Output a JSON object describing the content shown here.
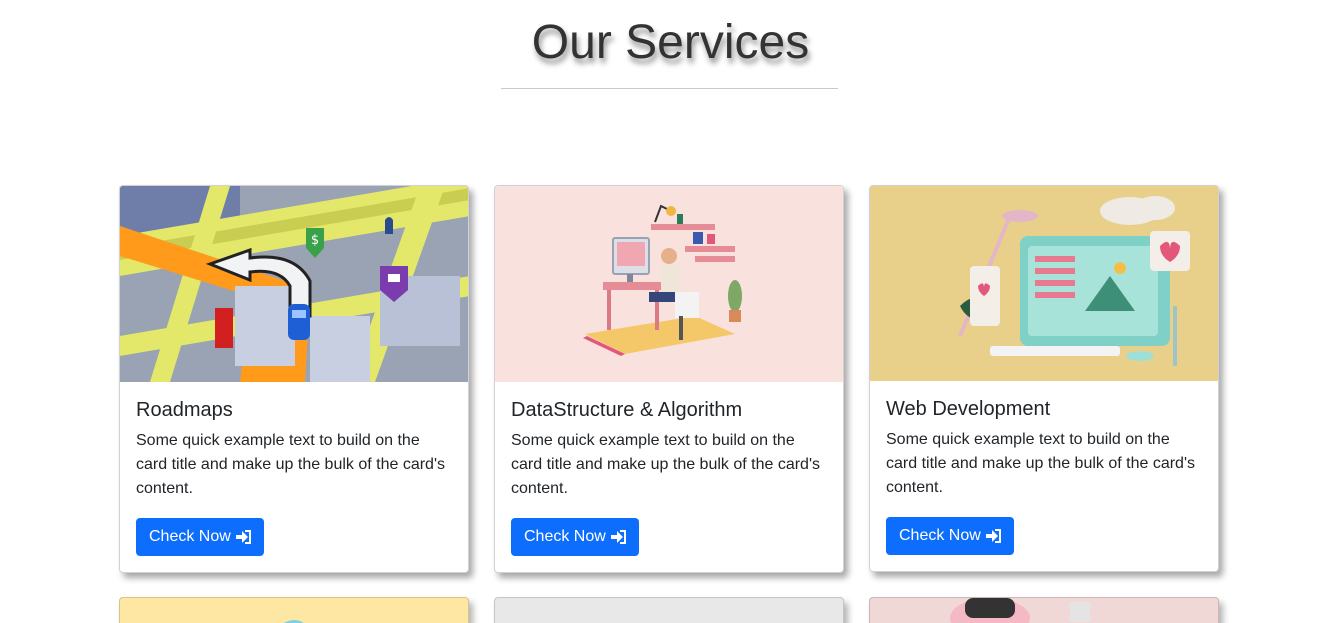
{
  "page": {
    "heading": "Our Services"
  },
  "cards": [
    {
      "title": "Roadmaps",
      "text": "Some quick example text to build on the card title and make up the bulk of the card's content.",
      "button_label": "Check Now",
      "button_icon": "sign-in-icon",
      "image": "navigation-map-illustration"
    },
    {
      "title": "DataStructure & Algorithm",
      "text": "Some quick example text to build on the card title and make up the bulk of the card's content.",
      "button_label": "Check Now",
      "button_icon": "sign-in-icon",
      "image": "desk-worker-illustration"
    },
    {
      "title": "Web Development",
      "text": "Some quick example text to build on the card title and make up the bulk of the card's content.",
      "button_label": "Check Now",
      "button_icon": "sign-in-icon",
      "image": "web-design-3d-illustration"
    }
  ],
  "colors": {
    "primary_button": "#0d6efd",
    "card1_bg": "#9aa6b8",
    "card2_bg": "#f9e2dd",
    "card3_bg": "#e8d08a",
    "row2_card1_bg": "#fde7a3",
    "row2_card2_bg": "#e8e8e8",
    "row2_card3_bg": "#f0d8d6"
  }
}
